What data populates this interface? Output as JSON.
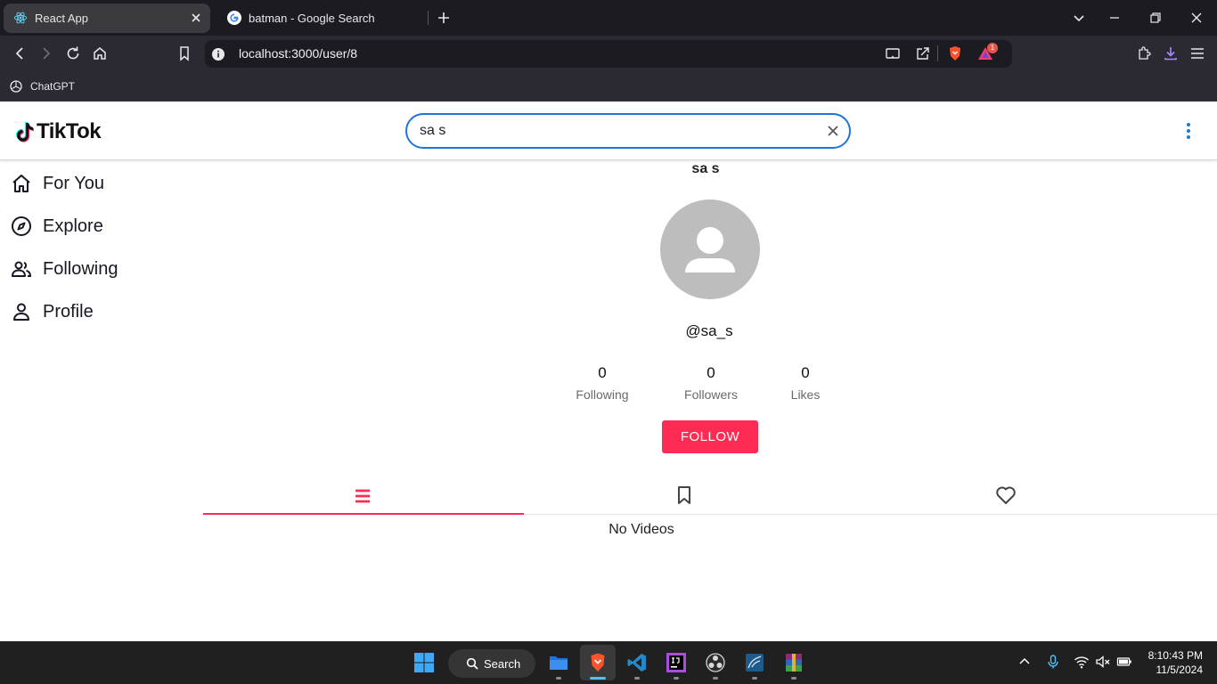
{
  "browser": {
    "tabs": [
      {
        "title": "React App",
        "active": true
      },
      {
        "title": "batman - Google Search",
        "active": false
      }
    ],
    "url": "localhost:3000/user/8",
    "extension_badge": "1",
    "bookmarks": [
      {
        "label": "ChatGPT"
      }
    ]
  },
  "app": {
    "logo": "TikTok",
    "search": {
      "value": "sa s",
      "placeholder": ""
    },
    "nav": [
      {
        "label": "For You",
        "icon": "home-icon"
      },
      {
        "label": "Explore",
        "icon": "compass-icon"
      },
      {
        "label": "Following",
        "icon": "people-icon"
      },
      {
        "label": "Profile",
        "icon": "person-icon"
      }
    ],
    "profile": {
      "name": "sa s",
      "handle": "@sa_s",
      "stats": [
        {
          "value": "0",
          "label": "Following"
        },
        {
          "value": "0",
          "label": "Followers"
        },
        {
          "value": "0",
          "label": "Likes"
        }
      ],
      "follow_label": "FOLLOW",
      "tabs": [
        {
          "icon": "list-icon",
          "active": true
        },
        {
          "icon": "bookmark-icon",
          "active": false
        },
        {
          "icon": "heart-icon",
          "active": false
        }
      ],
      "empty_message": "No Videos"
    },
    "colors": {
      "accent": "#fe2c55",
      "search_border": "#1f75d6",
      "kebab": "#1f75d6"
    }
  },
  "taskbar": {
    "search_label": "Search",
    "time": "8:10:43 PM",
    "date": "11/5/2024"
  }
}
